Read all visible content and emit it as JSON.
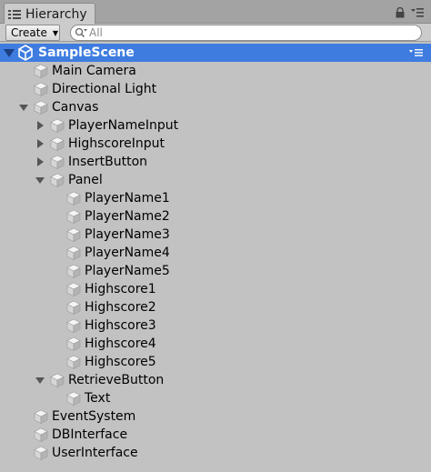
{
  "window": {
    "tab_title": "Hierarchy"
  },
  "toolbar": {
    "create_label": "Create",
    "search_placeholder": "All"
  },
  "scene": {
    "name": "SampleScene",
    "expanded": true
  },
  "tree": [
    {
      "label": "Main Camera",
      "depth": 0,
      "fold": "none"
    },
    {
      "label": "Directional Light",
      "depth": 0,
      "fold": "none"
    },
    {
      "label": "Canvas",
      "depth": 0,
      "fold": "open"
    },
    {
      "label": "PlayerNameInput",
      "depth": 1,
      "fold": "closed"
    },
    {
      "label": "HighscoreInput",
      "depth": 1,
      "fold": "closed"
    },
    {
      "label": "InsertButton",
      "depth": 1,
      "fold": "closed"
    },
    {
      "label": "Panel",
      "depth": 1,
      "fold": "open"
    },
    {
      "label": "PlayerName1",
      "depth": 2,
      "fold": "none"
    },
    {
      "label": "PlayerName2",
      "depth": 2,
      "fold": "none"
    },
    {
      "label": "PlayerName3",
      "depth": 2,
      "fold": "none"
    },
    {
      "label": "PlayerName4",
      "depth": 2,
      "fold": "none"
    },
    {
      "label": "PlayerName5",
      "depth": 2,
      "fold": "none"
    },
    {
      "label": "Highscore1",
      "depth": 2,
      "fold": "none"
    },
    {
      "label": "Highscore2",
      "depth": 2,
      "fold": "none"
    },
    {
      "label": "Highscore3",
      "depth": 2,
      "fold": "none"
    },
    {
      "label": "Highscore4",
      "depth": 2,
      "fold": "none"
    },
    {
      "label": "Highscore5",
      "depth": 2,
      "fold": "none"
    },
    {
      "label": "RetrieveButton",
      "depth": 1,
      "fold": "open"
    },
    {
      "label": "Text",
      "depth": 2,
      "fold": "none"
    },
    {
      "label": "EventSystem",
      "depth": 0,
      "fold": "none"
    },
    {
      "label": "DBInterface",
      "depth": 0,
      "fold": "none"
    },
    {
      "label": "UserInterface",
      "depth": 0,
      "fold": "none"
    }
  ],
  "icons": {
    "tab": "hierarchy-list-icon",
    "lock": "lock-icon",
    "menu": "panel-menu-icon",
    "search": "search-icon",
    "scene": "unity-logo-icon",
    "object": "gameobject-cube-icon"
  },
  "colors": {
    "selection": "#3e7ce0",
    "panel_bg": "#c2c2c2",
    "tab_strip": "#a3a3a3"
  }
}
